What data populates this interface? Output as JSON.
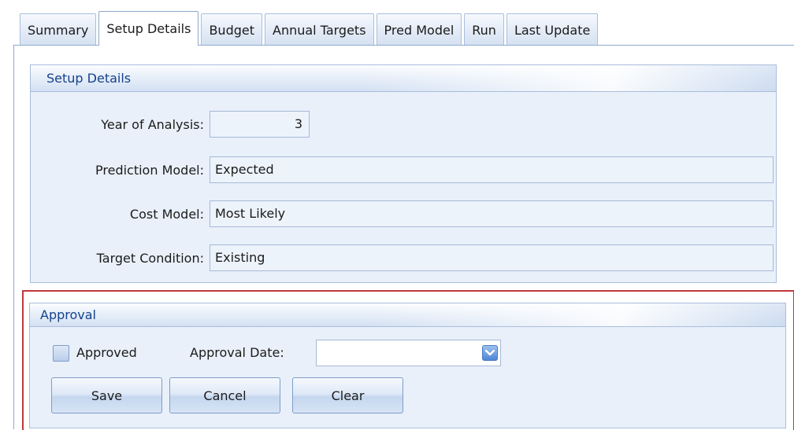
{
  "tabs": [
    {
      "label": "Summary"
    },
    {
      "label": "Setup Details"
    },
    {
      "label": "Budget"
    },
    {
      "label": "Annual Targets"
    },
    {
      "label": "Pred Model"
    },
    {
      "label": "Run"
    },
    {
      "label": "Last Update"
    }
  ],
  "active_tab": "Setup Details",
  "setup": {
    "title": "Setup Details",
    "year_label": "Year of Analysis:",
    "year_value": "3",
    "prediction_label": "Prediction Model:",
    "prediction_value": "Expected",
    "cost_label": "Cost Model:",
    "cost_value": "Most Likely",
    "target_label": "Target Condition:",
    "target_value": "Existing"
  },
  "approval": {
    "title": "Approval",
    "approved_label": "Approved",
    "approved_checked": false,
    "date_label": "Approval Date:",
    "date_value": "",
    "save_label": "Save",
    "cancel_label": "Cancel",
    "clear_label": "Clear"
  },
  "colors": {
    "panel_bg": "#e9f0fa",
    "header_text": "#15428b",
    "border": "#a9bedb",
    "highlight": "#c0393b"
  }
}
